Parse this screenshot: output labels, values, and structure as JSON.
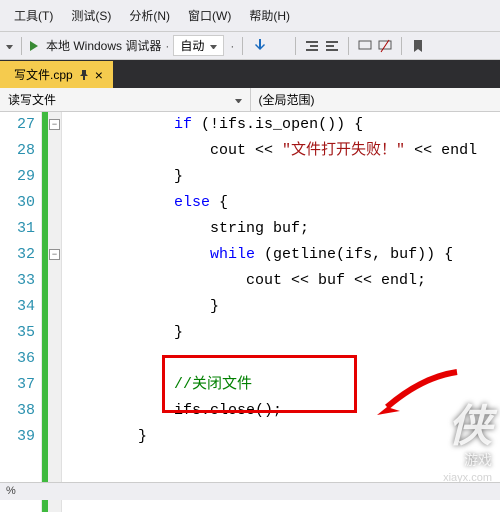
{
  "menu": {
    "tools": "工具(T)",
    "test": "测试(S)",
    "analyze": "分析(N)",
    "window": "窗口(W)",
    "help": "帮助(H)"
  },
  "toolbar": {
    "debug_label": "本地 Windows 调试器",
    "config": "自动"
  },
  "tab": {
    "name": "写文件.cpp",
    "close": "×"
  },
  "nav": {
    "left": "读写文件",
    "right": "(全局范围)"
  },
  "lines": {
    "l27": {
      "n": "27",
      "indent": "            ",
      "t1": "if",
      "t2": " (!ifs.is_open()) {"
    },
    "l28": {
      "n": "28",
      "indent": "                ",
      "t1": "cout << ",
      "t2": "\"文件打开失败！\"",
      "t3": " << endl"
    },
    "l29": {
      "n": "29",
      "indent": "            ",
      "t1": "}"
    },
    "l30": {
      "n": "30",
      "indent": "            ",
      "t1": "else",
      "t2": " {"
    },
    "l31": {
      "n": "31",
      "indent": "                ",
      "t1": "string buf;"
    },
    "l32": {
      "n": "32",
      "indent": "                ",
      "t1": "while",
      "t2": " (getline(ifs, buf)) {"
    },
    "l33": {
      "n": "33",
      "indent": "                    ",
      "t1": "cout << buf << endl;"
    },
    "l34": {
      "n": "34",
      "indent": "                ",
      "t1": "}"
    },
    "l35": {
      "n": "35",
      "indent": "            ",
      "t1": "}"
    },
    "l36": {
      "n": "36",
      "indent": "",
      "t1": ""
    },
    "l37": {
      "n": "37",
      "indent": "            ",
      "t1": "//关闭文件"
    },
    "l38": {
      "n": "38",
      "indent": "            ",
      "t1": "ifs.close();"
    },
    "l39": {
      "n": "39",
      "indent": "        ",
      "t1": "}"
    }
  },
  "watermark": {
    "logo": "侠",
    "sub": "游戏",
    "url": "xiayx.com"
  },
  "status": "%"
}
